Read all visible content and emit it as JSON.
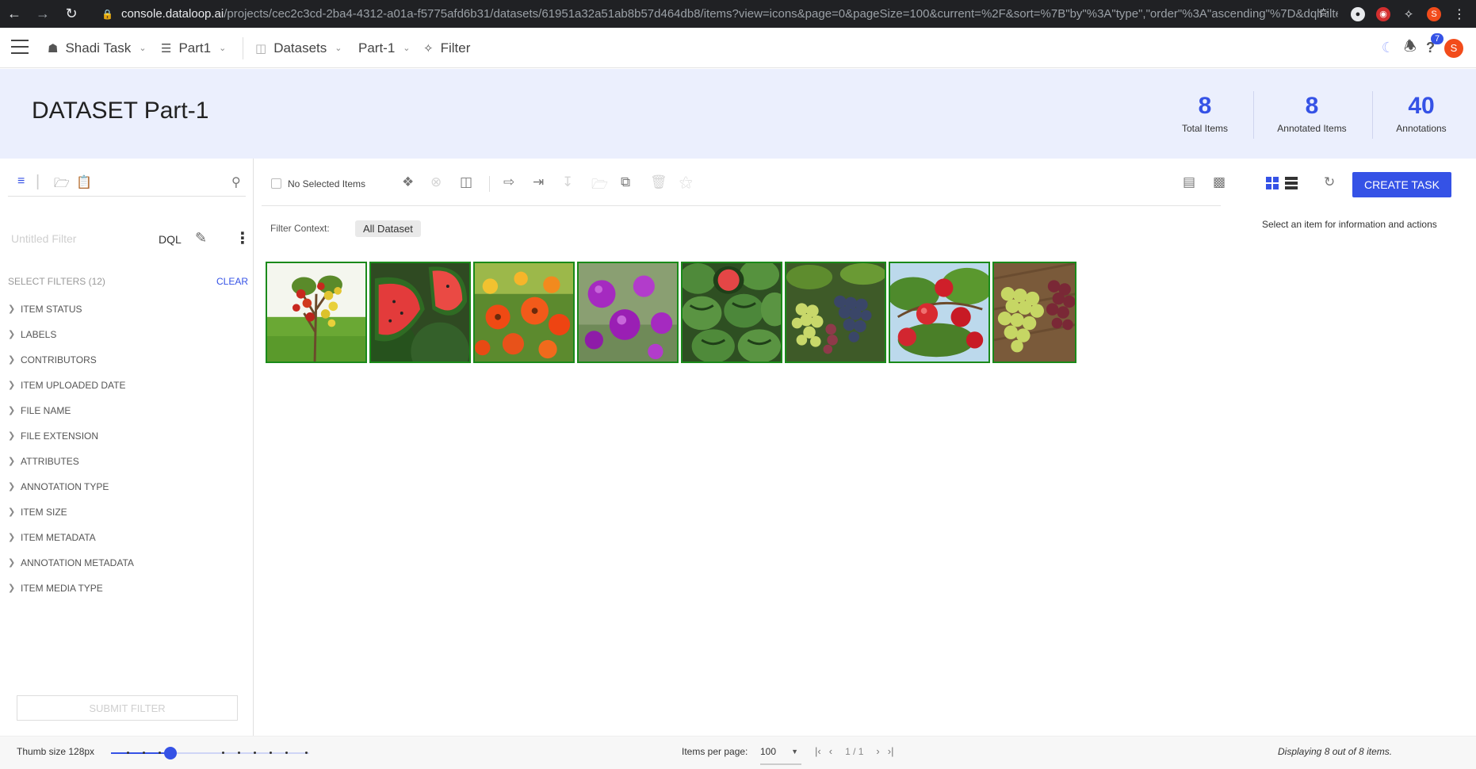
{
  "browser": {
    "url_host": "console.dataloop.ai",
    "url_path": "/projects/cec2c3cd-2ba4-4312-a01a-f5775afd6b31/datasets/61951a32a51ab8b57d464db8/items?view=icons&page=0&pageSize=100&current=%2F&sort=%7B\"by\"%3A\"type\",\"order\"%3A\"ascending\"%7D&dqlFilter=%7B\"fil...",
    "profile_initial": "S"
  },
  "appbar": {
    "project": "Shadi Task",
    "task": "Part1",
    "section": "Datasets",
    "dataset": "Part-1",
    "filter": "Filter",
    "help_badge": "7",
    "user_initial": "S"
  },
  "header": {
    "title": "DATASET Part-1",
    "stats": [
      {
        "value": "8",
        "label": "Total Items"
      },
      {
        "value": "8",
        "label": "Annotated Items"
      },
      {
        "value": "40",
        "label": "Annotations"
      }
    ]
  },
  "filters": {
    "name_placeholder": "Untitled Filter",
    "dql_label": "DQL",
    "select_label": "SELECT FILTERS (12)",
    "clear_label": "CLEAR",
    "items": [
      "ITEM STATUS",
      "LABELS",
      "CONTRIBUTORS",
      "ITEM UPLOADED DATE",
      "FILE NAME",
      "FILE EXTENSION",
      "ATTRIBUTES",
      "ANNOTATION TYPE",
      "ITEM SIZE",
      "ITEM METADATA",
      "ANNOTATION METADATA",
      "ITEM MEDIA TYPE"
    ],
    "submit_label": "SUBMIT FILTER"
  },
  "toolbar": {
    "no_selected": "No Selected Items",
    "create_task": "CREATE TASK"
  },
  "context": {
    "label": "Filter Context:",
    "value": "All Dataset",
    "info_hint": "Select an item for information and actions"
  },
  "thumbnails": [
    {
      "subject": "apple tree"
    },
    {
      "subject": "watermelon slices"
    },
    {
      "subject": "orange flowers"
    },
    {
      "subject": "purple flowers"
    },
    {
      "subject": "watermelons"
    },
    {
      "subject": "grapes"
    },
    {
      "subject": "red apples"
    },
    {
      "subject": "green and red grapes"
    }
  ],
  "footer": {
    "thumb_size": "Thumb size 128px",
    "thumb_size_fraction": 0.3,
    "items_per_page_label": "Items per page:",
    "items_per_page": "100",
    "page_indicator": "1 / 1",
    "displaying": "Displaying 8 out of 8 items."
  },
  "colors": {
    "accent": "#3552e6",
    "header_bg": "#ebeffd",
    "thumb_border": "#1a8a1a"
  }
}
